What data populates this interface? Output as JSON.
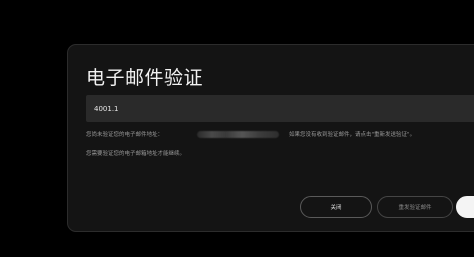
{
  "dialog": {
    "title": "电子邮件验证",
    "code_input": {
      "value": "4001.1"
    },
    "info": {
      "prefix": "您尚未验证您的电子邮件地址：",
      "suffix": "如果您没有收到验证邮件，请点击\"重新发送验证\"。"
    },
    "note": "您需要验证您的电子邮箱地址才能继续。",
    "buttons": {
      "close": "关闭",
      "resend": "重发验证邮件",
      "primary": ""
    }
  }
}
